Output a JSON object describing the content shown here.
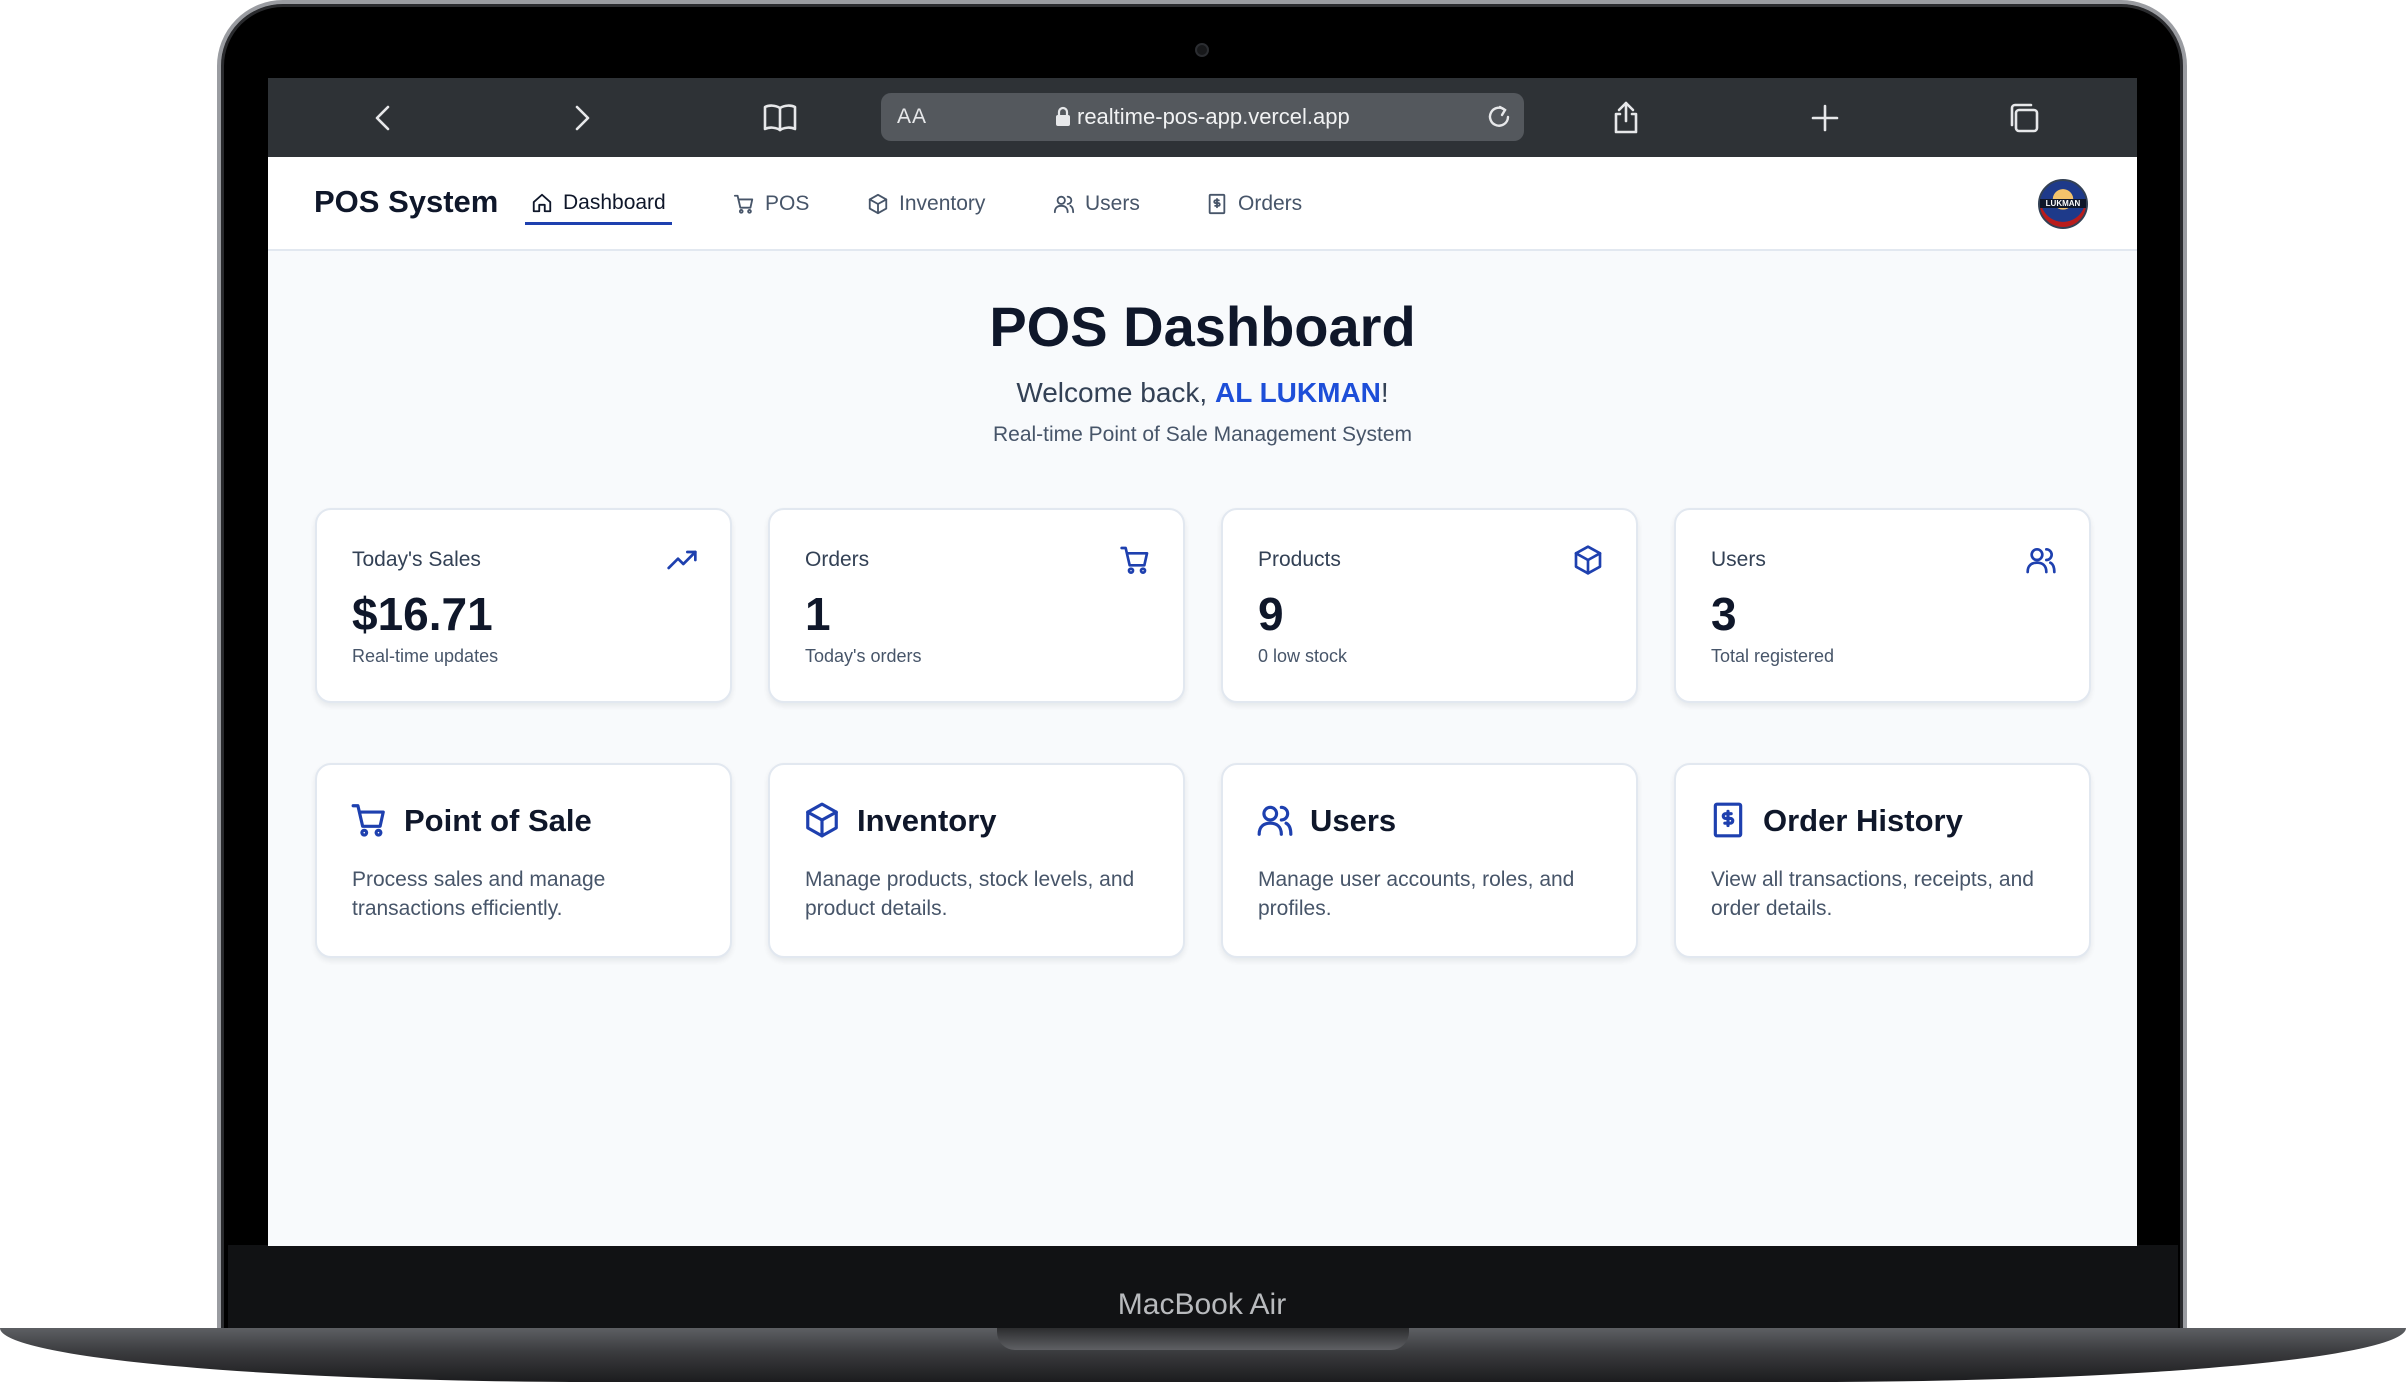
{
  "device": {
    "label": "MacBook Air"
  },
  "browser": {
    "text_size_label": "AA",
    "url": "realtime-pos-app.vercel.app"
  },
  "navbar": {
    "logo": "POS System",
    "items": [
      {
        "label": "Dashboard",
        "icon": "home-icon",
        "active": true
      },
      {
        "label": "POS",
        "icon": "cart-icon",
        "active": false
      },
      {
        "label": "Inventory",
        "icon": "package-icon",
        "active": false
      },
      {
        "label": "Users",
        "icon": "users-icon",
        "active": false
      },
      {
        "label": "Orders",
        "icon": "receipt-icon",
        "active": false
      }
    ],
    "avatar_text": "LUKMAN"
  },
  "header": {
    "title": "POS Dashboard",
    "welcome_prefix": "Welcome back, ",
    "user_name": "AL LUKMAN",
    "welcome_suffix": "!",
    "subtitle": "Real-time Point of Sale Management System"
  },
  "stats": [
    {
      "title": "Today's Sales",
      "value": "$16.71",
      "sub": "Real-time updates",
      "icon": "trending-up-icon"
    },
    {
      "title": "Orders",
      "value": "1",
      "sub": "Today's orders",
      "icon": "cart-icon"
    },
    {
      "title": "Products",
      "value": "9",
      "sub": "0 low stock",
      "icon": "package-icon"
    },
    {
      "title": "Users",
      "value": "3",
      "sub": "Total registered",
      "icon": "users-icon"
    }
  ],
  "features": [
    {
      "title": "Point of Sale",
      "description": "Process sales and manage transactions efficiently.",
      "icon": "cart-icon"
    },
    {
      "title": "Inventory",
      "description": "Manage products, stock levels, and product details.",
      "icon": "package-icon"
    },
    {
      "title": "Users",
      "description": "Manage user accounts, roles, and profiles.",
      "icon": "users-icon"
    },
    {
      "title": "Order History",
      "description": "View all transactions, receipts, and order details.",
      "icon": "receipt-icon"
    }
  ],
  "colors": {
    "accent": "#1e40af",
    "link": "#1d4ed8",
    "page_bg": "#f8fafc",
    "browser_bar": "#2e3236"
  }
}
